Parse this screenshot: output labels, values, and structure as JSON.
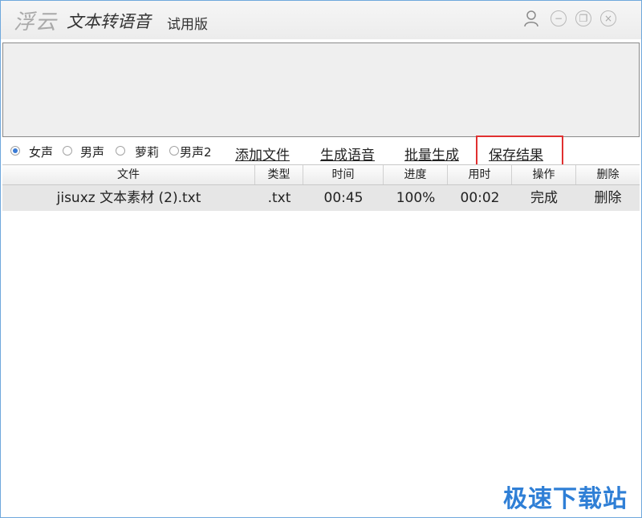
{
  "window": {
    "brand": "浮云",
    "title": "文本转语音",
    "edition": "试用版",
    "controls": {
      "minimize_glyph": "−",
      "restore_glyph": "❐",
      "close_glyph": "×"
    }
  },
  "editor": {
    "text": ""
  },
  "voices": [
    {
      "label": "女声",
      "selected": true
    },
    {
      "label": "男声",
      "selected": false
    },
    {
      "label": "萝莉",
      "selected": false
    },
    {
      "label": "男声2",
      "selected": false
    }
  ],
  "actions": {
    "add_file": "添加文件",
    "generate": "生成语音",
    "batch_generate": "批量生成",
    "save_result": "保存结果"
  },
  "table": {
    "columns": [
      "文件",
      "类型",
      "时间",
      "进度",
      "用时",
      "操作",
      "删除"
    ],
    "rows": [
      {
        "file": "jisuxz 文本素材 (2).txt",
        "type": ".txt",
        "time": "00:45",
        "progress": "100%",
        "elapsed": "00:02",
        "action": "完成",
        "delete": "删除"
      }
    ]
  },
  "watermark": "极速下载站",
  "colors": {
    "accent": "#3a7bd5",
    "highlight": "#e03030",
    "watermark": "#2f7fd6",
    "row_bg": "#e6e6e6"
  }
}
